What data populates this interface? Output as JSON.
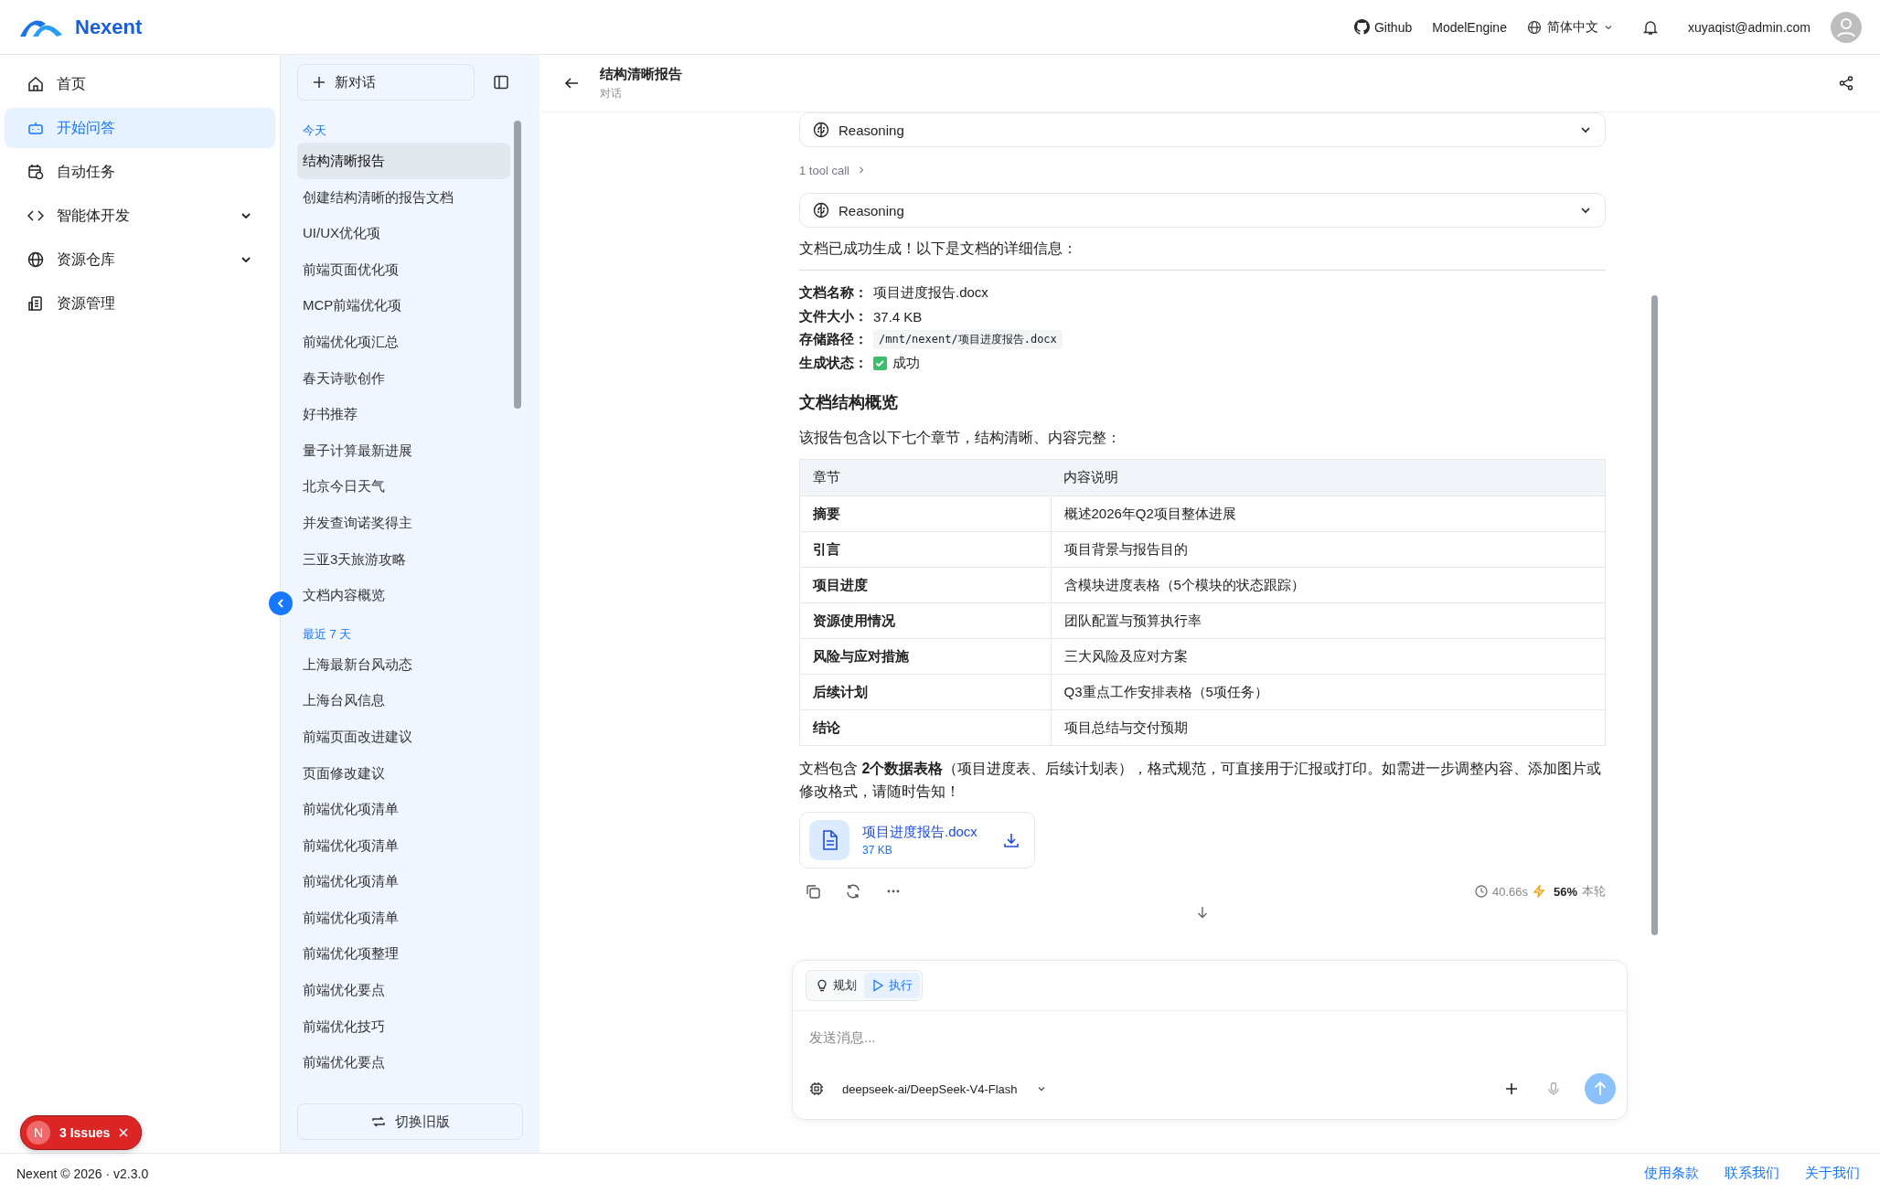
{
  "header": {
    "logo_text": "Nexent",
    "links": [
      {
        "kind": "github",
        "label": "Github"
      },
      {
        "kind": "plain",
        "label": "ModelEngine"
      }
    ],
    "language": "简体中文",
    "user": "xuyaqist@admin.com"
  },
  "nav": {
    "items": [
      {
        "label": "首页",
        "selected": false,
        "expandable": false
      },
      {
        "label": "开始问答",
        "selected": true,
        "expandable": false
      },
      {
        "label": "自动任务",
        "selected": false,
        "expandable": false
      },
      {
        "label": "智能体开发",
        "selected": false,
        "expandable": true
      },
      {
        "label": "资源仓库",
        "selected": false,
        "expandable": true
      },
      {
        "label": "资源管理",
        "selected": false,
        "expandable": false
      }
    ]
  },
  "conversations": {
    "new_button": "新对话",
    "groups": [
      {
        "label": "今天",
        "items": [
          {
            "title": "结构清晰报告",
            "selected": true
          },
          {
            "title": "创建结构清晰的报告文档",
            "selected": false
          },
          {
            "title": "UI/UX优化项",
            "selected": false
          },
          {
            "title": "前端页面优化项",
            "selected": false
          },
          {
            "title": "MCP前端优化项",
            "selected": false
          },
          {
            "title": "前端优化项汇总",
            "selected": false
          },
          {
            "title": "春天诗歌创作",
            "selected": false
          },
          {
            "title": "好书推荐",
            "selected": false
          },
          {
            "title": "量子计算最新进展",
            "selected": false
          },
          {
            "title": "北京今日天气",
            "selected": false
          },
          {
            "title": "并发查询诺奖得主",
            "selected": false
          },
          {
            "title": "三亚3天旅游攻略",
            "selected": false
          },
          {
            "title": "文档内容概览",
            "selected": false
          }
        ]
      },
      {
        "label": "最近 7 天",
        "items": [
          {
            "title": "上海最新台风动态",
            "selected": false
          },
          {
            "title": "上海台风信息",
            "selected": false
          },
          {
            "title": "前端页面改进建议",
            "selected": false
          },
          {
            "title": "页面修改建议",
            "selected": false
          },
          {
            "title": "前端优化项清单",
            "selected": false
          },
          {
            "title": "前端优化项清单",
            "selected": false
          },
          {
            "title": "前端优化项清单",
            "selected": false
          },
          {
            "title": "前端优化项清单",
            "selected": false
          },
          {
            "title": "前端优化项整理",
            "selected": false
          },
          {
            "title": "前端优化要点",
            "selected": false
          },
          {
            "title": "前端优化技巧",
            "selected": false
          },
          {
            "title": "前端优化要点",
            "selected": false
          }
        ]
      }
    ],
    "switch_button": "切换旧版"
  },
  "chat": {
    "title": "结构清晰报告",
    "subtitle": "对话",
    "steps": [
      {
        "kind": "reasoning",
        "label": "Reasoning"
      },
      {
        "kind": "tool",
        "label": "1 tool call"
      },
      {
        "kind": "reasoning",
        "label": "Reasoning"
      }
    ],
    "intro": "文档已成功生成！以下是文档的详细信息：",
    "details": [
      {
        "label": "文档名称：",
        "kind": "text",
        "value": "项目进度报告.docx"
      },
      {
        "label": "文件大小：",
        "kind": "text",
        "value": "37.4 KB"
      },
      {
        "label": "存储路径：",
        "kind": "code",
        "value": "/mnt/nexent/项目进度报告.docx"
      },
      {
        "label": "生成状态：",
        "kind": "status",
        "value": "成功"
      }
    ],
    "heading": "文档结构概览",
    "lead": "该报告包含以下七个章节，结构清晰、内容完整：",
    "table": {
      "columns": [
        "章节",
        "内容说明"
      ],
      "rows": [
        [
          "摘要",
          "概述2026年Q2项目整体进展"
        ],
        [
          "引言",
          "项目背景与报告目的"
        ],
        [
          "项目进度",
          "含模块进度表格（5个模块的状态跟踪）"
        ],
        [
          "资源使用情况",
          "团队配置与预算执行率"
        ],
        [
          "风险与应对措施",
          "三大风险及应对方案"
        ],
        [
          "后续计划",
          "Q3重点工作安排表格（5项任务）"
        ],
        [
          "结论",
          "项目总结与交付预期"
        ]
      ]
    },
    "closing": "文档包含 **2个数据表格**（项目进度表、后续计划表），格式规范，可直接用于汇报或打印。如需进一步调整内容、添加图片或修改格式，请随时告知！",
    "attachment": {
      "name": "项目进度报告.docx",
      "size": "37 KB"
    },
    "stats": {
      "time": "40.66s",
      "percent": "56%",
      "label": "本轮"
    }
  },
  "composer": {
    "modes": [
      {
        "label": "规划",
        "selected": false
      },
      {
        "label": "执行",
        "selected": true
      }
    ],
    "placeholder": "发送消息...",
    "model": "deepseek-ai/DeepSeek-V4-Flash"
  },
  "issues": {
    "letter": "N",
    "label": "3 Issues"
  },
  "footer": {
    "copyright": "Nexent © 2026 · v2.3.0",
    "links": [
      "使用条款",
      "联系我们",
      "关于我们"
    ]
  }
}
